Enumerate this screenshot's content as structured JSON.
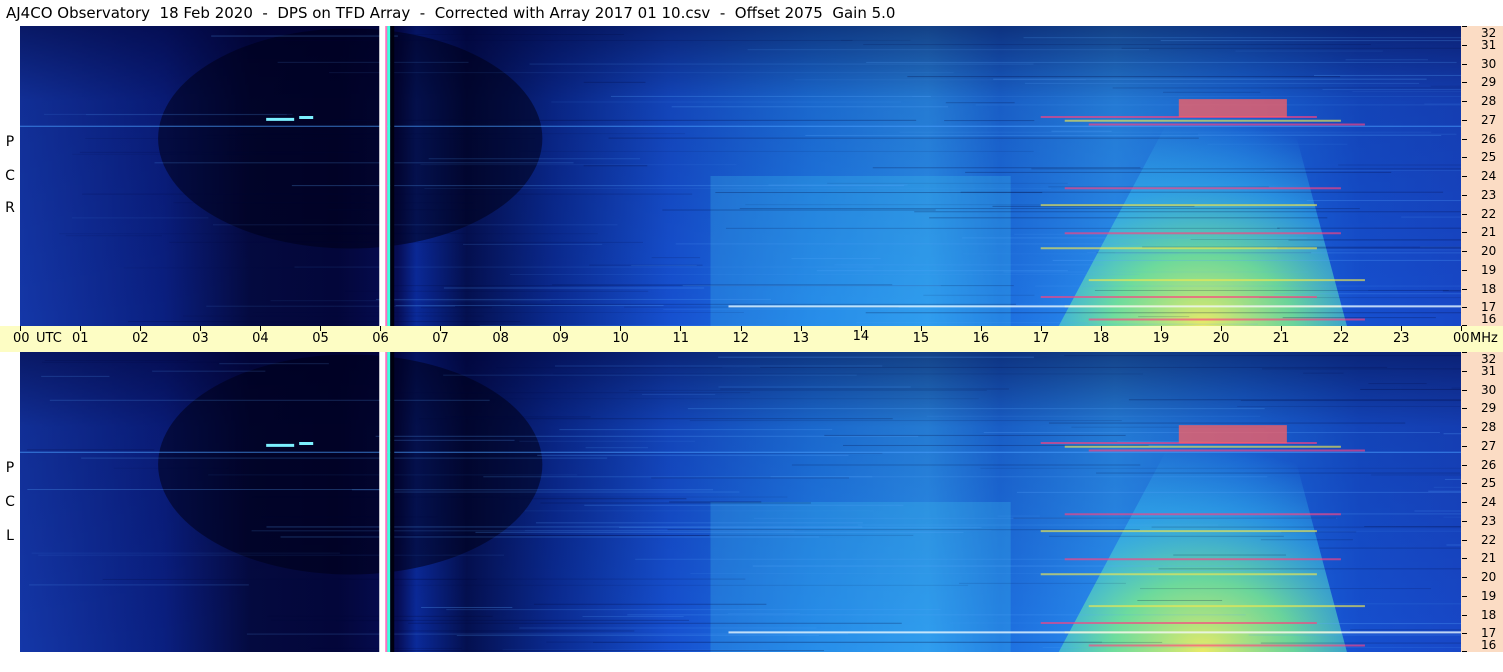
{
  "header": {
    "title": "AJ4CO Observatory  18 Feb 2020  -  DPS on TFD Array  -  Corrected with Array 2017 01 10.csv  -  Offset 2075  Gain 5.0"
  },
  "panels": {
    "top_label": [
      "R",
      "C",
      "P"
    ],
    "bottom_label": [
      "L",
      "C",
      "P"
    ]
  },
  "chart_data": {
    "type": "heatmap",
    "title": "AJ4CO Observatory  18 Feb 2020  -  DPS on TFD Array  -  Corrected with Array 2017 01 10.csv  -  Offset 2075  Gain 5.0",
    "xlabel": "UTC",
    "ylabel": "MHz",
    "xlim": [
      0,
      24
    ],
    "ylim": [
      16,
      32
    ],
    "x_ticks": [
      "00",
      "01",
      "02",
      "03",
      "04",
      "05",
      "06",
      "07",
      "08",
      "09",
      "10",
      "11",
      "12",
      "13",
      "14",
      "15",
      "16",
      "17",
      "18",
      "19",
      "20",
      "21",
      "22",
      "23",
      "00"
    ],
    "x_axis_units_label": "UTC",
    "y_ticks": [
      "32",
      "31",
      "30",
      "29",
      "28",
      "27",
      "26",
      "25",
      "24",
      "23",
      "22",
      "21",
      "20",
      "19",
      "18",
      "17",
      "16"
    ],
    "y_axis_units_label": "MHz",
    "panels": [
      "RCP",
      "LCP"
    ],
    "colors": {
      "background_low": "#02043a",
      "mid": "#1a5fe0",
      "high": "#3ac8f0",
      "peak": "#f0f040",
      "hot": "#ff3070"
    }
  }
}
